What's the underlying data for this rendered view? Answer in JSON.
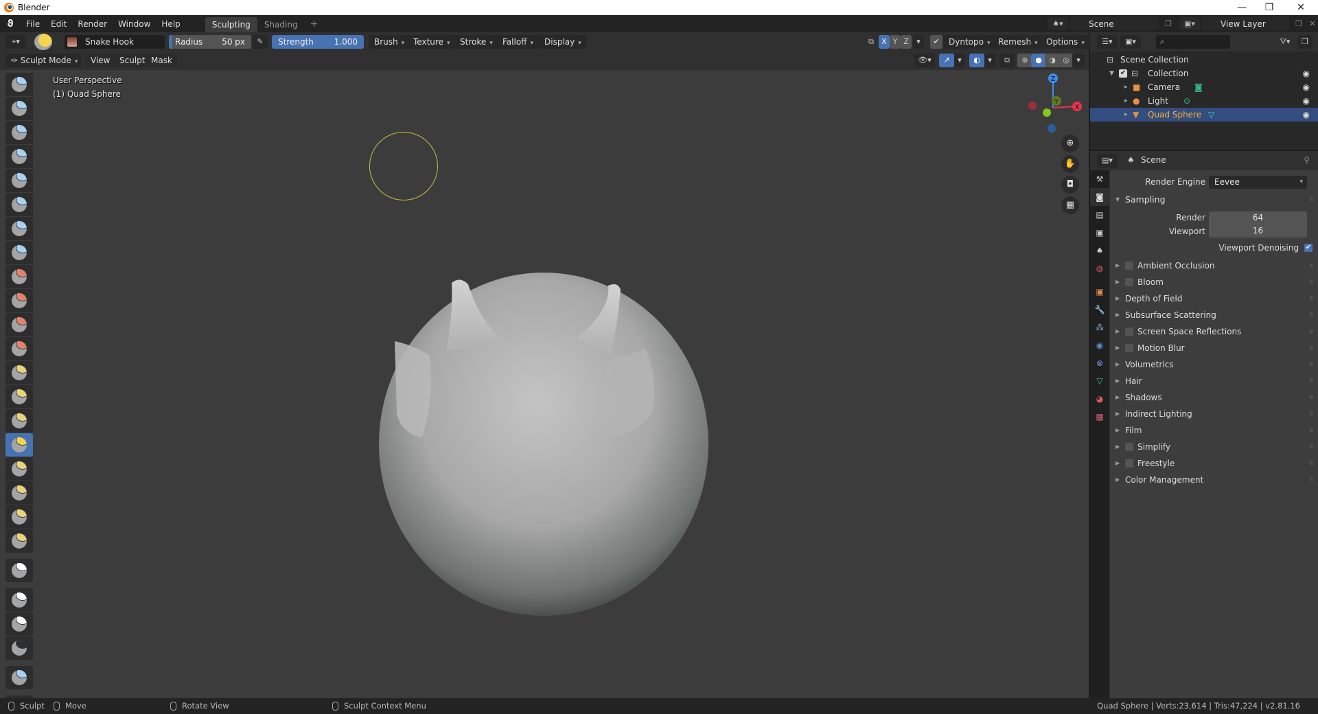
{
  "window": {
    "title": "Blender",
    "controls": [
      "—",
      "❐",
      "✕"
    ]
  },
  "menubar": {
    "items": [
      "File",
      "Edit",
      "Render",
      "Window",
      "Help"
    ],
    "workspaces": [
      {
        "label": "Sculpting",
        "active": true
      },
      {
        "label": "Shading",
        "active": false
      }
    ],
    "add_workspace": "+",
    "scene": "Scene",
    "view_layer": "View Layer"
  },
  "tool_header": {
    "brush_name": "Snake Hook",
    "radius": {
      "label": "Radius",
      "value": "50 px"
    },
    "strength": {
      "label": "Strength",
      "value": "1.000",
      "fraction": 1.0
    },
    "menus": [
      "Brush",
      "Texture",
      "Stroke",
      "Falloff",
      "Display"
    ],
    "symmetry": [
      "X",
      "Y",
      "Z"
    ],
    "dyntopo": {
      "label": "Dyntopo",
      "checked": true
    },
    "remesh": "Remesh",
    "options": "Options"
  },
  "viewport_header": {
    "mode": "Sculpt Mode",
    "menus": [
      "View",
      "Sculpt",
      "Mask"
    ]
  },
  "viewport": {
    "perspective": "User Perspective",
    "object": "(1) Quad Sphere",
    "brush_cursor_color": "#c8c040",
    "gizmo": {
      "x": "X",
      "y": "Y",
      "z": "Z"
    }
  },
  "toolbar": {
    "active_tool": "snake-hook",
    "tools": [
      {
        "name": "draw",
        "color": "#a9d1f2"
      },
      {
        "name": "draw-sharp",
        "color": "#a9d1f2"
      },
      {
        "name": "clay",
        "color": "#a9d1f2"
      },
      {
        "name": "clay-strips",
        "color": "#a9d1f2"
      },
      {
        "name": "layer",
        "color": "#a9d1f2"
      },
      {
        "name": "inflate",
        "color": "#a9d1f2"
      },
      {
        "name": "blob",
        "color": "#a9d1f2"
      },
      {
        "name": "crease",
        "color": "#a9d1f2"
      },
      {
        "name": "smooth",
        "color": "#e3826b"
      },
      {
        "name": "flatten",
        "color": "#e3826b"
      },
      {
        "name": "fill",
        "color": "#e3826b"
      },
      {
        "name": "scrape",
        "color": "#e3826b"
      },
      {
        "name": "pinch",
        "color": "#e8d27a"
      },
      {
        "name": "grab",
        "color": "#e8d27a"
      },
      {
        "name": "elastic-deform",
        "color": "#e8d27a"
      },
      {
        "name": "snake-hook",
        "color": "#f5d44e"
      },
      {
        "name": "thumb",
        "color": "#e8d27a"
      },
      {
        "name": "pose",
        "color": "#e8d27a"
      },
      {
        "name": "nudge",
        "color": "#e8d27a"
      },
      {
        "name": "rotate",
        "color": "#e8d27a"
      },
      {
        "name": "simplify",
        "color": "#ffffff"
      },
      {
        "name": "mask",
        "color": "#ffffff"
      },
      {
        "name": "box-mask",
        "color": "#ffffff"
      },
      {
        "name": "box-hide",
        "color": "#2e2e2e"
      },
      {
        "name": "mesh-filter",
        "color": "#a9d1f2"
      },
      {
        "name": "transform",
        "color": "#ffffff"
      }
    ]
  },
  "outliner": {
    "root": "Scene Collection",
    "items": [
      {
        "label": "Collection",
        "type": "collection",
        "checked": true,
        "visible": true
      },
      {
        "label": "Camera",
        "type": "camera",
        "visible": true
      },
      {
        "label": "Light",
        "type": "light",
        "visible": true
      },
      {
        "label": "Quad Sphere",
        "type": "mesh",
        "visible": true,
        "selected": true
      }
    ]
  },
  "properties": {
    "context": "Scene",
    "render_engine": {
      "label": "Render Engine",
      "value": "Eevee"
    },
    "sampling": {
      "label": "Sampling",
      "render": {
        "label": "Render",
        "value": "64"
      },
      "viewport": {
        "label": "Viewport",
        "value": "16"
      },
      "denoising": {
        "label": "Viewport Denoising",
        "checked": true
      }
    },
    "panels": [
      {
        "label": "Ambient Occlusion",
        "checkbox": true
      },
      {
        "label": "Bloom",
        "checkbox": true
      },
      {
        "label": "Depth of Field",
        "checkbox": false
      },
      {
        "label": "Subsurface Scattering",
        "checkbox": false
      },
      {
        "label": "Screen Space Reflections",
        "checkbox": true
      },
      {
        "label": "Motion Blur",
        "checkbox": true
      },
      {
        "label": "Volumetrics",
        "checkbox": false
      },
      {
        "label": "Hair",
        "checkbox": false
      },
      {
        "label": "Shadows",
        "checkbox": false
      },
      {
        "label": "Indirect Lighting",
        "checkbox": false
      },
      {
        "label": "Film",
        "checkbox": false
      },
      {
        "label": "Simplify",
        "checkbox": true
      },
      {
        "label": "Freestyle",
        "checkbox": true
      },
      {
        "label": "Color Management",
        "checkbox": false
      }
    ],
    "tabs": [
      "tool",
      "render",
      "output",
      "view-layer",
      "scene",
      "world",
      "object",
      "modifiers",
      "particles",
      "physics",
      "constraints",
      "data",
      "material",
      "texture"
    ]
  },
  "statusbar": {
    "left_mouse": "Sculpt",
    "middle_drag": "Move",
    "middle": "Rotate View",
    "right_mouse": "Sculpt Context Menu",
    "stats": "Quad Sphere | Verts:23,614 | Tris:47,224 | v2.81.16"
  },
  "colors": {
    "accent": "#4772b3",
    "selection": "#334d80",
    "active_object_text": "#ffaf29"
  }
}
